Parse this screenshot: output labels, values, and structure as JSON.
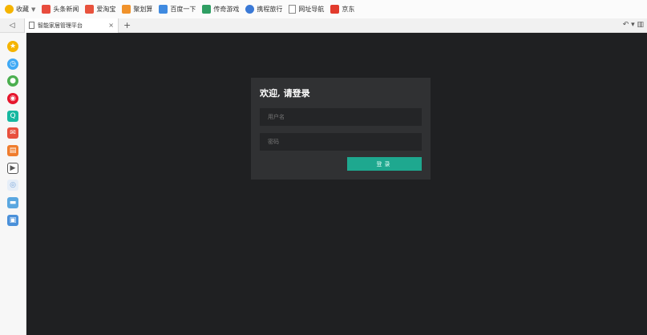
{
  "bookmarks": [
    {
      "label": "收藏",
      "icon": "star-icon",
      "color": "#f5b400",
      "has_caret": true
    },
    {
      "label": "头条新闻",
      "icon": "news-icon",
      "color": "#e84c3d"
    },
    {
      "label": "爱淘宝",
      "icon": "taobao-icon",
      "color": "#e8523d"
    },
    {
      "label": "聚划算",
      "icon": "juhuasuan-icon",
      "color": "#f0922b"
    },
    {
      "label": "百度一下",
      "icon": "baidu-icon",
      "color": "#3f8ae0"
    },
    {
      "label": "传奇游戏",
      "icon": "game-icon",
      "color": "#2f9e63"
    },
    {
      "label": "携程旅行",
      "icon": "ctrip-icon",
      "color": "#3a79d6"
    },
    {
      "label": "网址导航",
      "icon": "document-icon",
      "color": "#888888"
    },
    {
      "label": "京东",
      "icon": "jd-icon",
      "color": "#e23b2d"
    }
  ],
  "tabbar": {
    "nav_glyph": "◁",
    "active_tab": {
      "title": "智能家居管理平台",
      "close": "×"
    },
    "new_tab": "+",
    "right_controls": "↶ ▾ ▥"
  },
  "sidebar": {
    "icons": [
      {
        "name": "favorites-star-icon",
        "glyph": "★",
        "color": "#f5b400"
      },
      {
        "name": "history-clock-icon",
        "glyph": "◷",
        "color": "#3fa9f5"
      },
      {
        "name": "games-icon",
        "glyph": "●",
        "color": "#4caf50"
      },
      {
        "name": "weibo-icon",
        "glyph": "◉",
        "color": "#e6162d"
      },
      {
        "name": "search-icon",
        "glyph": "Q",
        "color": "#16b8a0"
      },
      {
        "name": "mail-icon",
        "glyph": "✉",
        "color": "#e8503d"
      },
      {
        "name": "news-icon",
        "glyph": "▤",
        "color": "#ef7d2e"
      },
      {
        "name": "video-icon",
        "glyph": "▶",
        "color": "#555555"
      },
      {
        "name": "gamepad-icon",
        "glyph": "◎",
        "color": "#7aa6d9"
      },
      {
        "name": "notes-icon",
        "glyph": "▬",
        "color": "#5aa7e0"
      },
      {
        "name": "save-icon",
        "glyph": "▣",
        "color": "#4a90d9"
      }
    ]
  },
  "login": {
    "title": "欢迎, 请登录",
    "username_placeholder": "用户名",
    "password_placeholder": "密码",
    "submit_label": "登录"
  },
  "colors": {
    "page_background": "#1f2022",
    "panel_background": "#303133",
    "input_background": "#242527",
    "accent": "#1ea88f"
  }
}
